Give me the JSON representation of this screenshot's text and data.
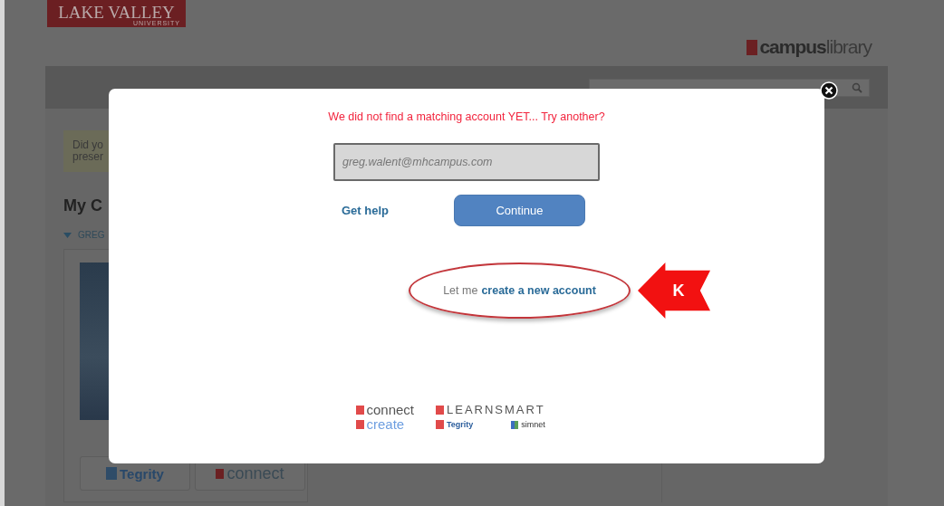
{
  "header": {
    "logo_title": "LAKE VALLEY",
    "logo_subtitle": "UNIVERSITY",
    "brand_bold": "campus",
    "brand_light": "library"
  },
  "notice": {
    "lines": [
      "Did yo",
      "preser"
    ]
  },
  "courses": {
    "heading": "My C",
    "section": "GREG",
    "section_expanded": true,
    "tools": [
      {
        "kind": "tegrity",
        "label": "Tegrity"
      },
      {
        "kind": "connect",
        "label": "connect"
      }
    ]
  },
  "dialog": {
    "message": "We did not find a matching account YET... Try another?",
    "email": "greg.walent@mhcampus.com",
    "help_link": "Get help",
    "continue_button": "Continue",
    "create_prefix": "Let me",
    "create_link": "create a new account",
    "callout": "K",
    "logos": [
      {
        "kind": "red-mark",
        "label": "connect"
      },
      {
        "kind": "red-mark",
        "label": "LEARNSMART"
      },
      {
        "kind": "red-mark",
        "label": "create"
      },
      {
        "kind": "red-mark",
        "label": "Tegrity"
      },
      {
        "kind": "grid-mark",
        "label": "simnet"
      }
    ]
  }
}
